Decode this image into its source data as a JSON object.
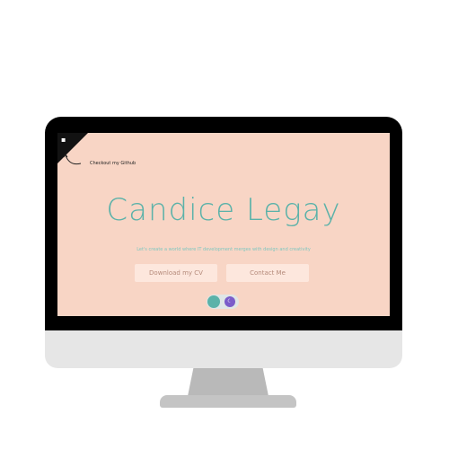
{
  "github": {
    "label": "Checkout my Github",
    "icon": "github-icon"
  },
  "hero": {
    "name": "Candice Legay",
    "tagline": "Let's create a world where IT development merges with design and creativity"
  },
  "buttons": {
    "download_cv": "Download my CV",
    "contact": "Contact Me"
  },
  "theme_toggle": {
    "icon": "moon-icon",
    "state": "light"
  },
  "colors": {
    "background": "#f8d5c5",
    "accent": "#5bb2a9",
    "button_bg": "#fde7dd",
    "toggle_icon": "#7b5cc9"
  }
}
